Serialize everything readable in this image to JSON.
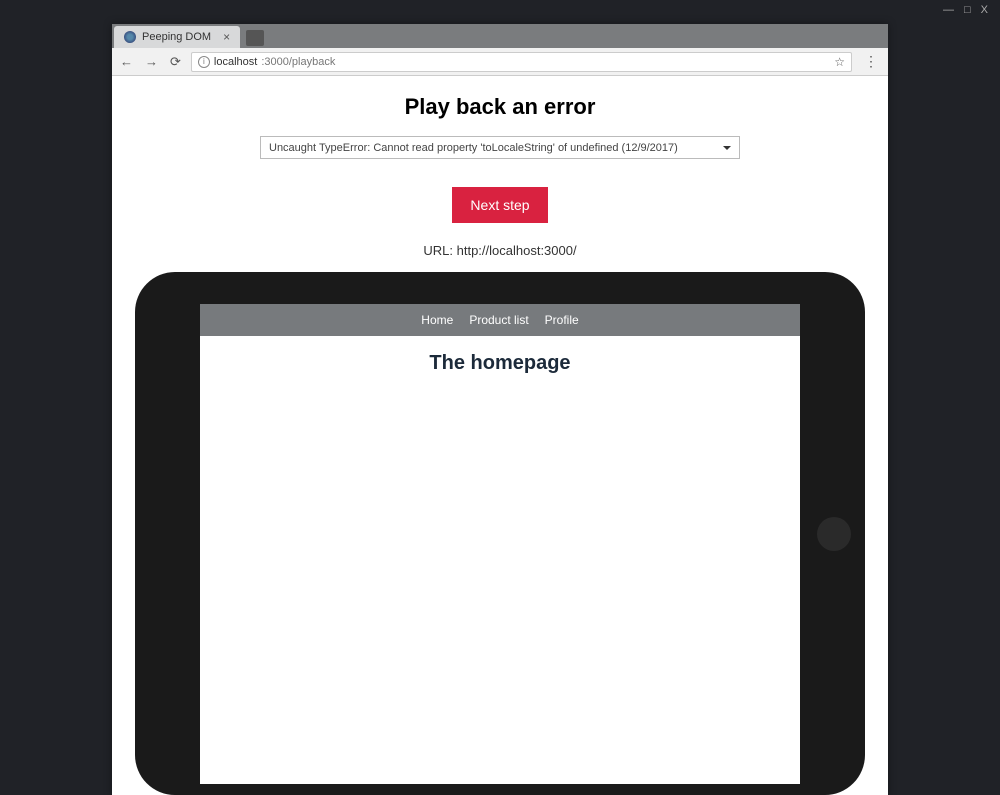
{
  "window": {
    "controls": {
      "minimize": "—",
      "maximize": "□",
      "close": "X"
    }
  },
  "browser": {
    "tab": {
      "title": "Peeping DOM",
      "close": "×"
    },
    "url": {
      "host": "localhost",
      "rest": ":3000/playback"
    }
  },
  "page": {
    "title": "Play back an error",
    "error_select": "Uncaught TypeError: Cannot read property 'toLocaleString' of undefined (12/9/2017)",
    "next_button": "Next step",
    "url_label": "URL: http://localhost:3000/"
  },
  "preview": {
    "nav": {
      "home": "Home",
      "product_list": "Product list",
      "profile": "Profile"
    },
    "heading": "The homepage"
  }
}
